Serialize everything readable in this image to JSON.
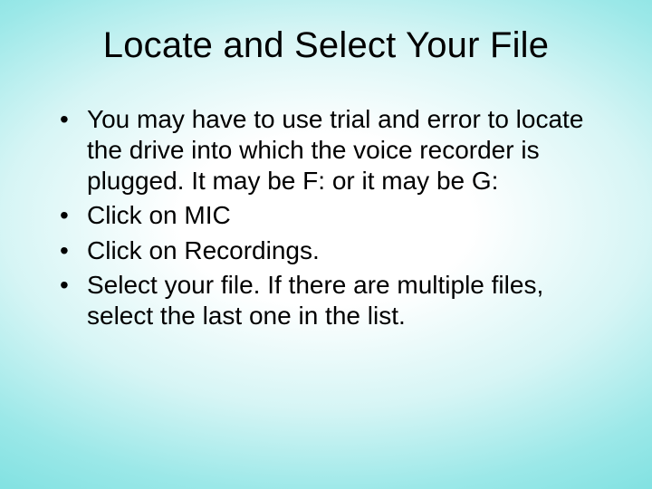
{
  "slide": {
    "title": "Locate and Select Your File",
    "bullets": [
      "You may have to use trial and error to locate the drive into which the voice recorder is plugged.  It may be F: or it may be G:",
      "Click on MIC",
      "Click on Recordings.",
      "Select your file.  If there are multiple files, select the last one in the list."
    ]
  }
}
